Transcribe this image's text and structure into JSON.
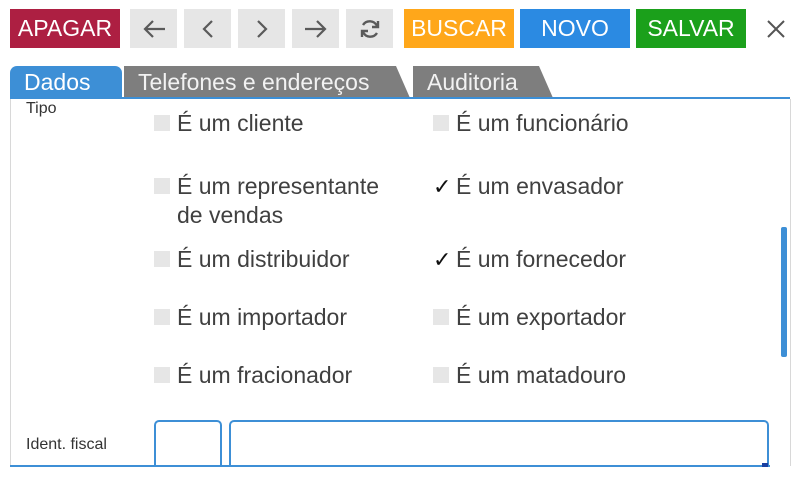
{
  "toolbar": {
    "delete_label": "APAGAR",
    "search_label": "BUSCAR",
    "new_label": "NOVO",
    "save_label": "SALVAR",
    "close_icon": "close-icon",
    "nav_icons": [
      "first-arrow-icon",
      "previous-chevron-icon",
      "next-chevron-icon",
      "last-arrow-icon",
      "refresh-icon"
    ]
  },
  "tabs": [
    {
      "label": "Dados",
      "active": true
    },
    {
      "label": "Telefones e endereços",
      "active": false
    },
    {
      "label": "Auditoria",
      "active": false
    }
  ],
  "form": {
    "tipo_label": "Tipo",
    "options": [
      {
        "label": "É um cliente",
        "checked": false
      },
      {
        "label": "É um funcionário",
        "checked": false
      },
      {
        "label": "É um representante",
        "label2": "de vendas",
        "checked": false
      },
      {
        "label": "É um envasador",
        "checked": true
      },
      {
        "label": "É um distribuidor",
        "checked": false
      },
      {
        "label": "É um fornecedor",
        "checked": true
      },
      {
        "label": "É um importador",
        "checked": false
      },
      {
        "label": "É um exportador",
        "checked": false
      },
      {
        "label": "É um fracionador",
        "checked": false
      },
      {
        "label": "É um matadouro",
        "checked": false
      }
    ],
    "ident_label": "Ident. fiscal",
    "ident_type_value": "",
    "ident_number_value": "",
    "checkmark": "✓"
  },
  "colors": {
    "delete": "#ad1f42",
    "search": "#ffa71a",
    "new": "#2b8ae2",
    "save": "#1ba01b",
    "tab_active": "#3d8fd6",
    "tab_inactive": "#7e7e7e"
  }
}
